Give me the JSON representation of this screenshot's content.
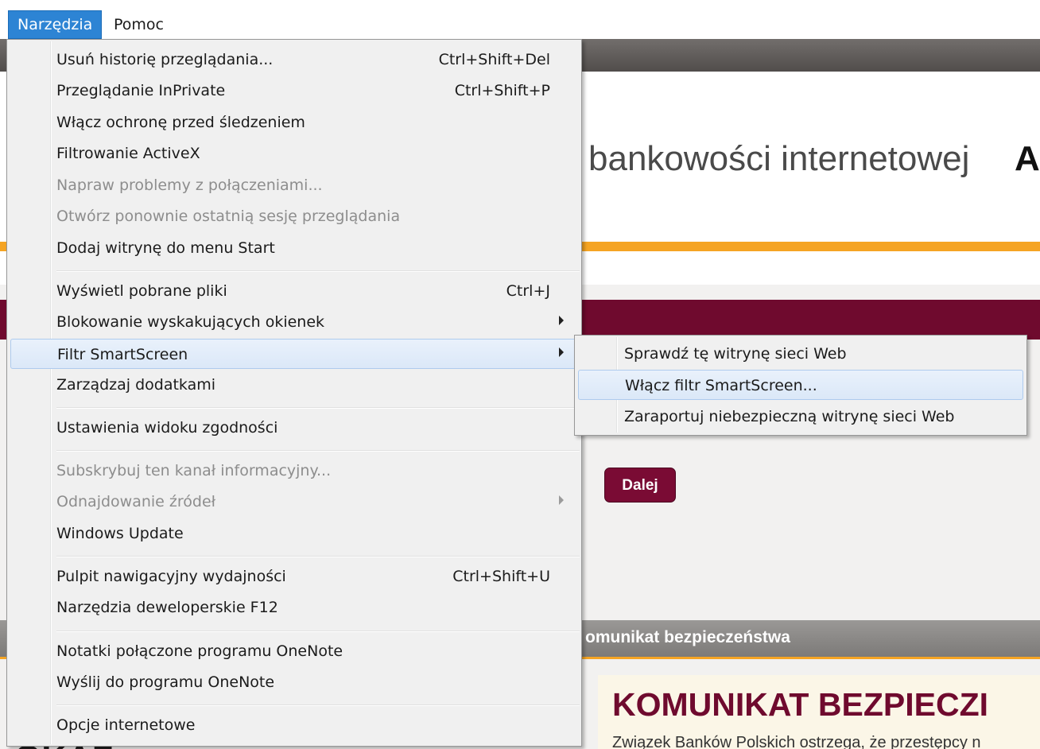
{
  "menubar": {
    "items": [
      {
        "label": "Narzędzia"
      },
      {
        "label": "Pomoc"
      }
    ]
  },
  "page": {
    "heading": "bankowości internetowej",
    "heading_cut": "A",
    "button_next": "Dalej",
    "security_header": "omunikat bezpieczeństwa",
    "security_title": "KOMUNIKAT BEZPIECZI",
    "security_text": "Związek Banków Polskich ostrzega, że przestępcy n",
    "bottom_text": "OKAZ"
  },
  "tools_menu": {
    "items": [
      {
        "label": "Usuń historię przeglądania...",
        "shortcut": "Ctrl+Shift+Del"
      },
      {
        "label": "Przeglądanie InPrivate",
        "shortcut": "Ctrl+Shift+P"
      },
      {
        "label": "Włącz ochronę przed śledzeniem",
        "shortcut": ""
      },
      {
        "label": "Filtrowanie ActiveX",
        "shortcut": ""
      },
      {
        "label": "Napraw problemy z połączeniami...",
        "shortcut": ""
      },
      {
        "label": "Otwórz ponownie ostatnią sesję przeglądania",
        "shortcut": ""
      },
      {
        "label": "Dodaj witrynę do menu Start",
        "shortcut": ""
      },
      {
        "label": "Wyświetl pobrane pliki",
        "shortcut": "Ctrl+J"
      },
      {
        "label": "Blokowanie wyskakujących okienek",
        "shortcut": ""
      },
      {
        "label": "Filtr SmartScreen",
        "shortcut": ""
      },
      {
        "label": "Zarządzaj dodatkami",
        "shortcut": ""
      },
      {
        "label": "Ustawienia widoku zgodności",
        "shortcut": ""
      },
      {
        "label": "Subskrybuj ten kanał informacyjny...",
        "shortcut": ""
      },
      {
        "label": "Odnajdowanie źródeł",
        "shortcut": ""
      },
      {
        "label": "Windows Update",
        "shortcut": ""
      },
      {
        "label": "Pulpit nawigacyjny wydajności",
        "shortcut": "Ctrl+Shift+U"
      },
      {
        "label": "Narzędzia deweloperskie F12",
        "shortcut": ""
      },
      {
        "label": "Notatki połączone programu OneNote",
        "shortcut": ""
      },
      {
        "label": "Wyślij do programu OneNote",
        "shortcut": ""
      },
      {
        "label": "Opcje internetowe",
        "shortcut": ""
      }
    ]
  },
  "smartscreen_submenu": {
    "items": [
      {
        "label": "Sprawdź tę witrynę sieci Web"
      },
      {
        "label": "Włącz filtr SmartScreen..."
      },
      {
        "label": "Zaraportuj niebezpieczną witrynę sieci Web"
      }
    ]
  },
  "colors": {
    "menubar_active": "#2d84d4",
    "menu_background": "#f0f0f0",
    "menu_hover": "#dbe8f8",
    "disabled_text": "#8d8d8d",
    "page_maroon": "#6f0a2e",
    "page_orange": "#f5a423"
  }
}
